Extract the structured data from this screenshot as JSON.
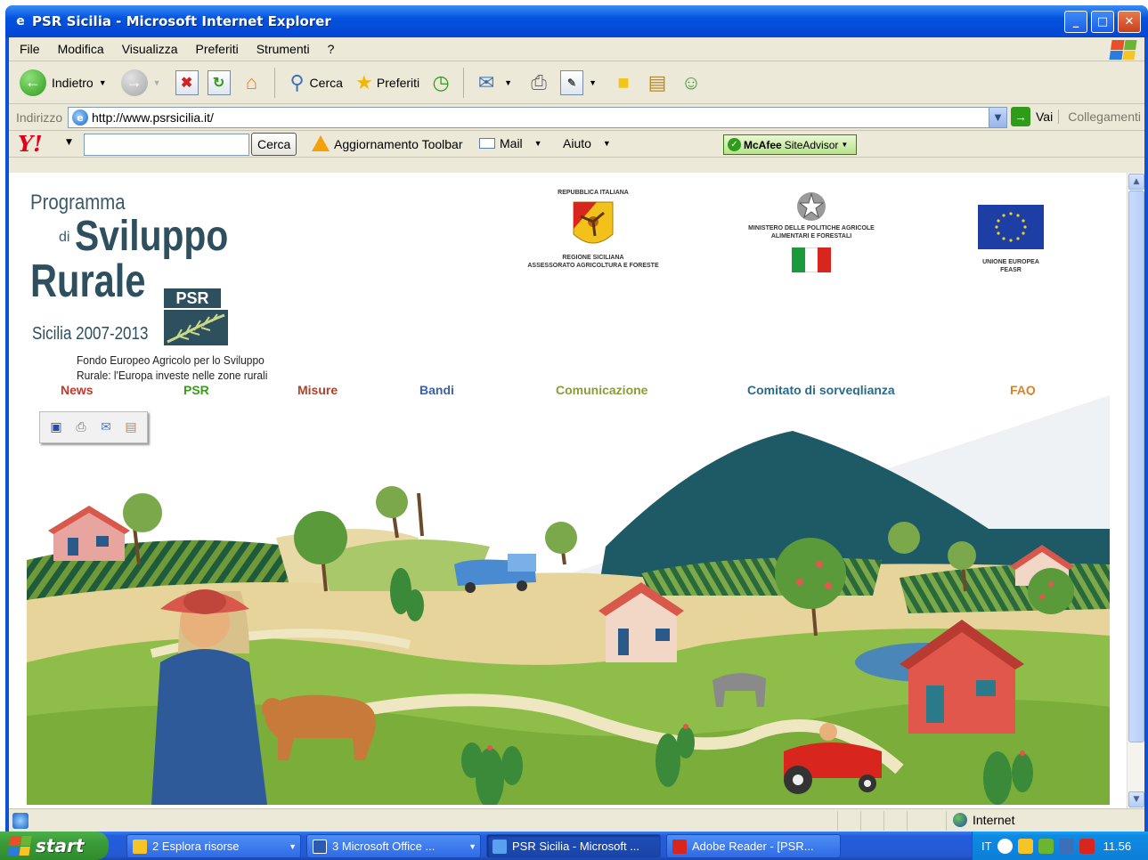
{
  "window": {
    "title": "PSR Sicilia - Microsoft Internet Explorer"
  },
  "menu": [
    "File",
    "Modifica",
    "Visualizza",
    "Preferiti",
    "Strumenti",
    "?"
  ],
  "toolbar": {
    "back_label": "Indietro",
    "search_label": "Cerca",
    "favorites_label": "Preferiti"
  },
  "address": {
    "label": "Indirizzo",
    "url": "http://www.psrsicilia.it/",
    "go_label": "Vai",
    "links_label": "Collegamenti"
  },
  "yahoo": {
    "logo": "Y!",
    "search_button": "Cerca",
    "update_label": "Aggiornamento Toolbar",
    "mail_label": "Mail",
    "help_label": "Aiuto",
    "mcafee_brand": "McAfee",
    "mcafee_label": "SiteAdvisor"
  },
  "page": {
    "logo_line1": "Programma",
    "logo_di": "di",
    "logo_line2": "Sviluppo",
    "logo_line3": "Rurale",
    "logo_badge": "PSR",
    "logo_line4": "Sicilia 2007-2013",
    "logo_subtitle": "Fondo Europeo Agricolo per lo Sviluppo Rurale: l'Europa investe nelle zone rurali",
    "emblems": {
      "regione_top": "REPUBBLICA ITALIANA",
      "regione_bottom1": "REGIONE SICILIANA",
      "regione_bottom2": "ASSESSORATO AGRICOLTURA E FORESTE",
      "ministero1": "MINISTERO DELLE POLITICHE AGRICOLE",
      "ministero2": "ALIMENTARI E FORESTALI",
      "ue1": "UNIONE EUROPEA",
      "ue2": "FEASR"
    },
    "nav": [
      {
        "label": "News",
        "color": "#c0392b"
      },
      {
        "label": "PSR",
        "color": "#3c9a1e"
      },
      {
        "label": "Misure",
        "color": "#b0412a"
      },
      {
        "label": "Bandi",
        "color": "#3d5fa8"
      },
      {
        "label": "Comunicazione",
        "color": "#8c9b3a"
      },
      {
        "label": "Comitato di sorveglianza",
        "color": "#2a6b8a"
      },
      {
        "label": "FAQ",
        "color": "#d9822b"
      }
    ]
  },
  "status": {
    "zone": "Internet"
  },
  "taskbar": {
    "start_label": "start",
    "tasks": [
      "2 Esplora risorse",
      "3 Microsoft Office ...",
      "PSR Sicilia - Microsoft ...",
      "Adobe Reader - [PSR..."
    ],
    "lang": "IT",
    "clock": "11.56"
  }
}
